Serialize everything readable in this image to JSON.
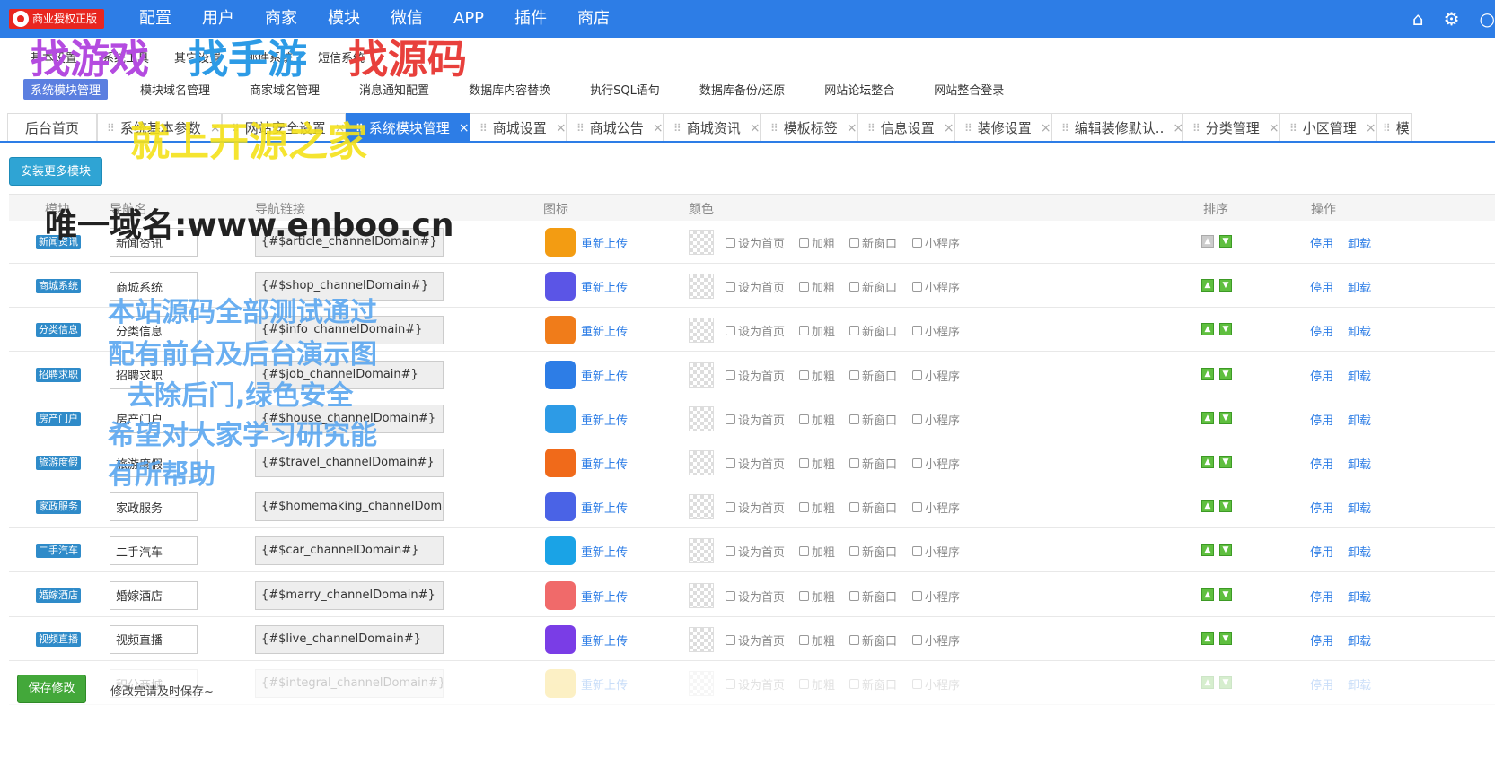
{
  "brand": "商业授权正版",
  "topnav": [
    "配置",
    "用户",
    "商家",
    "模块",
    "微信",
    "APP",
    "插件",
    "商店"
  ],
  "subnav1": [
    "基本设置",
    "系统工具",
    "其它设置",
    "邮件系统",
    "短信系统"
  ],
  "subnav2": [
    "系统模块管理",
    "模块域名管理",
    "商家域名管理",
    "消息通知配置",
    "数据库内容替换",
    "执行SQL语句",
    "数据库备份/还原",
    "网站论坛整合",
    "网站整合登录"
  ],
  "tabs": [
    "后台首页",
    "系统基本参数",
    "网站安全设置",
    "系统模块管理",
    "商城设置",
    "商城公告",
    "商城资讯",
    "模板标签",
    "信息设置",
    "装修设置",
    "编辑装修默认..",
    "分类管理",
    "小区管理",
    "模"
  ],
  "install_btn": "安装更多模块",
  "headers": {
    "module": "模块",
    "nav_name": "导航名",
    "nav_link": "导航链接",
    "icon": "图标",
    "color": "颜色",
    "sort": "排序",
    "ops": "操作"
  },
  "reupload": "重新上传",
  "checks": [
    "设为首页",
    "加粗",
    "新窗口",
    "小程序"
  ],
  "ops": [
    "停用",
    "卸载"
  ],
  "rows": [
    {
      "badge": "新闻资讯",
      "name": "新闻资讯",
      "link": "{#$article_channelDomain#}",
      "color": "#f39c12"
    },
    {
      "badge": "商城系统",
      "name": "商城系统",
      "link": "{#$shop_channelDomain#}",
      "color": "#5b55e6"
    },
    {
      "badge": "分类信息",
      "name": "分类信息",
      "link": "{#$info_channelDomain#}",
      "color": "#f07c1a"
    },
    {
      "badge": "招聘求职",
      "name": "招聘求职",
      "link": "{#$job_channelDomain#}",
      "color": "#2d7de6"
    },
    {
      "badge": "房产门户",
      "name": "房产门户",
      "link": "{#$house_channelDomain#}",
      "color": "#2d9be6"
    },
    {
      "badge": "旅游度假",
      "name": "旅游度假",
      "link": "{#$travel_channelDomain#}",
      "color": "#f06a1a"
    },
    {
      "badge": "家政服务",
      "name": "家政服务",
      "link": "{#$homemaking_channelDoma",
      "color": "#4a63e6"
    },
    {
      "badge": "二手汽车",
      "name": "二手汽车",
      "link": "{#$car_channelDomain#}",
      "color": "#1aa3e6"
    },
    {
      "badge": "婚嫁酒店",
      "name": "婚嫁酒店",
      "link": "{#$marry_channelDomain#}",
      "color": "#f06a6a"
    },
    {
      "badge": "视频直播",
      "name": "视频直播",
      "link": "{#$live_channelDomain#}",
      "color": "#7a3de6"
    },
    {
      "badge": "",
      "name": "积分商城",
      "link": "{#$integral_channelDomain#}",
      "color": "#f5c518"
    }
  ],
  "save_btn": "保存修改",
  "save_hint": "修改完请及时保存~",
  "watermarks": {
    "w1": "找游戏",
    "w2": "找手游",
    "w3": "找源码",
    "w4": "就上开源之家",
    "domain": "唯一域名:www.enboo.cn",
    "l1": "本站源码全部测试通过",
    "l2": "配有前台及后台演示图",
    "l3": "去除后门,绿色安全",
    "l4": "希望对大家学习研究能",
    "l5": "有所帮助"
  }
}
